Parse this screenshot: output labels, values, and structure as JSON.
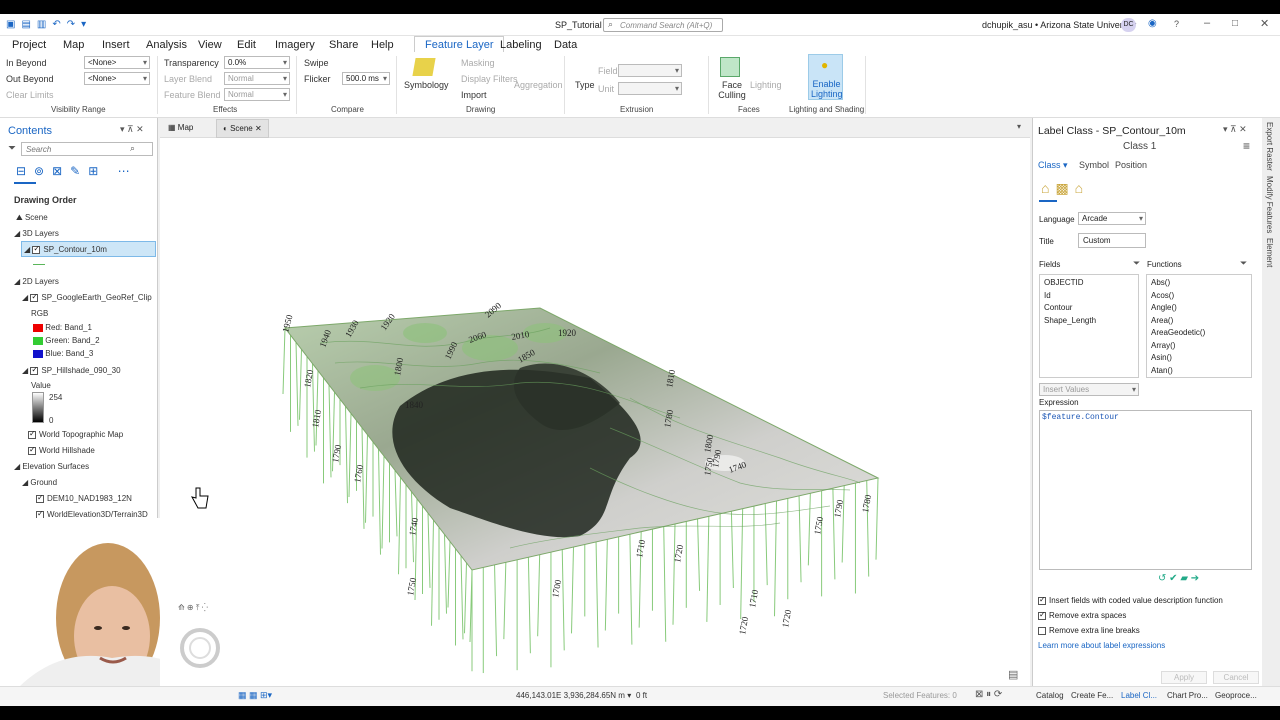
{
  "window": {
    "title": "SP_Tutorial",
    "search_placeholder": "Command Search (Alt+Q)",
    "user": "dchupik_asu • Arizona State University",
    "user_initials": "DC",
    "accent": "#1a66c4"
  },
  "menu": [
    "Project",
    "Map",
    "Insert",
    "Analysis",
    "View",
    "Edit",
    "Imagery",
    "Share",
    "Help",
    "Feature Layer",
    "Labeling",
    "Data"
  ],
  "ribbon": {
    "in_beyond": "In Beyond",
    "out_beyond": "Out Beyond",
    "clear_limits": "Clear Limits",
    "none1": "<None>",
    "none2": "<None>",
    "visibility_range": "Visibility Range",
    "transparency": "Transparency",
    "transparency_val": "0.0%",
    "layer_blend": "Layer Blend",
    "layer_blend_val": "Normal",
    "feature_blend": "Feature Blend",
    "feature_blend_val": "Normal",
    "effects": "Effects",
    "swipe": "Swipe",
    "flicker": "Flicker",
    "flicker_val": "500.0",
    "flicker_unit": "ms",
    "compare": "Compare",
    "symbology": "Symbology",
    "masking": "Masking",
    "display_filters": "Display Filters",
    "import": "Import",
    "aggregation": "Aggregation",
    "drawing": "Drawing",
    "type": "Type",
    "field": "Field",
    "unit": "Unit",
    "extrusion": "Extrusion",
    "face_culling": "Face Culling",
    "faces": "Faces",
    "lighting": "Lighting",
    "enable_lighting": "Enable Lighting",
    "lighting_shading": "Lighting and Shading"
  },
  "contents": {
    "title": "Contents",
    "search_placeholder": "Search",
    "drawing_order": "Drawing Order",
    "items": {
      "scene": "Scene",
      "layers3d": "3D Layers",
      "contour": "SP_Contour_10m",
      "layers2d": "2D Layers",
      "georef": "SP_GoogleEarth_GeoRef_Clip",
      "rgb": "RGB",
      "red": "Red:",
      "red_band": "Band_1",
      "green": "Green:",
      "green_band": "Band_2",
      "blue": "Blue:",
      "blue_band": "Band_3",
      "hillshade": "SP_Hillshade_090_30",
      "value": "Value",
      "v254": "254",
      "v0": "0",
      "topo": "World Topographic Map",
      "world_hillshade": "World Hillshade",
      "elevation": "Elevation Surfaces",
      "ground": "Ground",
      "dem": "DEM10_NAD1983_12N",
      "world_elev": "WorldElevation3D/Terrain3D"
    }
  },
  "tabs": {
    "map": "Map",
    "scene": "Scene"
  },
  "contour_labels": [
    {
      "t": "1950"
    },
    {
      "t": "1940"
    },
    {
      "t": "1930"
    },
    {
      "t": "1920"
    },
    {
      "t": "2090"
    },
    {
      "t": "2060"
    },
    {
      "t": "2010"
    },
    {
      "t": "1920"
    },
    {
      "t": "1990"
    },
    {
      "t": "1850"
    },
    {
      "t": "1820"
    },
    {
      "t": "1840"
    },
    {
      "t": "1800"
    },
    {
      "t": "1810"
    },
    {
      "t": "1790"
    },
    {
      "t": "1760"
    },
    {
      "t": "1740"
    },
    {
      "t": "1750"
    },
    {
      "t": "1700"
    },
    {
      "t": "1710"
    },
    {
      "t": "1720"
    },
    {
      "t": "1720"
    },
    {
      "t": "1710"
    },
    {
      "t": "1720"
    },
    {
      "t": "1750"
    },
    {
      "t": "1790"
    },
    {
      "t": "1780"
    },
    {
      "t": "1810"
    },
    {
      "t": "1800"
    },
    {
      "t": "1740"
    },
    {
      "t": "1780"
    },
    {
      "t": "1750"
    },
    {
      "t": "1790"
    }
  ],
  "label_class": {
    "title": "Label Class - SP_Contour_10m",
    "class_name": "Class 1",
    "tabs": [
      "Class",
      "Symbol",
      "Position"
    ],
    "language_label": "Language",
    "language": "Arcade",
    "title_label": "Title",
    "title_value": "Custom",
    "fields_label": "Fields",
    "functions_label": "Functions",
    "fields": [
      "OBJECTID",
      "Id",
      "Contour",
      "Shape_Length"
    ],
    "functions": [
      "Abs()",
      "Acos()",
      "Angle()",
      "Area()",
      "AreaGeodetic()",
      "Array()",
      "Asin()",
      "Atan()"
    ],
    "insert_values": "Insert Values",
    "expression_label": "Expression",
    "expression": "$feature.Contour",
    "opt1": "Insert fields with coded value description function",
    "opt2": "Remove extra spaces",
    "opt3": "Remove extra line breaks",
    "learn_more": "Learn more about label expressions",
    "apply": "Apply",
    "cancel": "Cancel"
  },
  "side_tabs": [
    "Export Raster",
    "Modify Features",
    "Element"
  ],
  "status": {
    "coords": "446,143.01E 3,936,284.65N m",
    "elev": "0 ft",
    "selected": "Selected Features: 0"
  },
  "bottom_tabs": [
    "Catalog",
    "Create Fe...",
    "Label Cl...",
    "Chart Pro...",
    "Geoproce..."
  ]
}
